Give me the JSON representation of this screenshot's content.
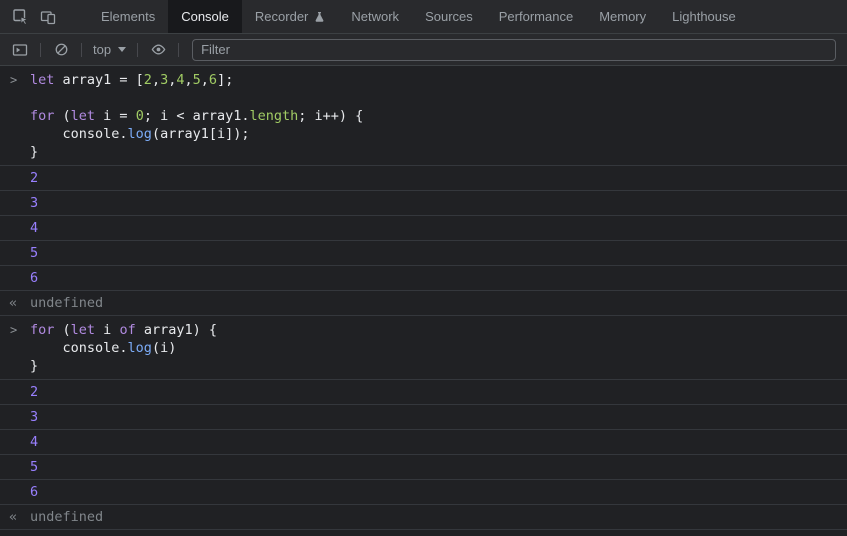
{
  "tabbar": {
    "tabs": [
      {
        "label": "Elements",
        "active": false
      },
      {
        "label": "Console",
        "active": true
      },
      {
        "label": "Recorder",
        "active": false,
        "badge": true
      },
      {
        "label": "Network",
        "active": false
      },
      {
        "label": "Sources",
        "active": false
      },
      {
        "label": "Performance",
        "active": false
      },
      {
        "label": "Memory",
        "active": false
      },
      {
        "label": "Lighthouse",
        "active": false
      }
    ]
  },
  "toolbar": {
    "context_label": "top",
    "filter_placeholder": "Filter"
  },
  "icons": {
    "input_chevron": ">",
    "return_arrow": "«"
  },
  "console_panel": {
    "entries": [
      {
        "type": "input",
        "lines": [
          [
            {
              "c": "kw",
              "t": "let"
            },
            {
              "c": "d",
              "t": " array1 = ["
            },
            {
              "c": "num",
              "t": "2"
            },
            {
              "c": "d",
              "t": ","
            },
            {
              "c": "num",
              "t": "3"
            },
            {
              "c": "d",
              "t": ","
            },
            {
              "c": "num",
              "t": "4"
            },
            {
              "c": "d",
              "t": ","
            },
            {
              "c": "num",
              "t": "5"
            },
            {
              "c": "d",
              "t": ","
            },
            {
              "c": "num",
              "t": "6"
            },
            {
              "c": "d",
              "t": "];"
            }
          ],
          [],
          [
            {
              "c": "kw",
              "t": "for"
            },
            {
              "c": "d",
              "t": " ("
            },
            {
              "c": "kw",
              "t": "let"
            },
            {
              "c": "d",
              "t": " i = "
            },
            {
              "c": "num",
              "t": "0"
            },
            {
              "c": "d",
              "t": "; i < array1."
            },
            {
              "c": "num",
              "t": "length"
            },
            {
              "c": "d",
              "t": "; i++) {"
            }
          ],
          [
            {
              "c": "d",
              "t": "    console."
            },
            {
              "c": "prop",
              "t": "log"
            },
            {
              "c": "d",
              "t": "(array1[i]);"
            }
          ],
          [
            {
              "c": "d",
              "t": "}"
            }
          ]
        ]
      },
      {
        "type": "result",
        "text": "2"
      },
      {
        "type": "result",
        "text": "3"
      },
      {
        "type": "result",
        "text": "4"
      },
      {
        "type": "result",
        "text": "5"
      },
      {
        "type": "result",
        "text": "6"
      },
      {
        "type": "return",
        "text": "undefined"
      },
      {
        "type": "input",
        "lines": [
          [
            {
              "c": "kw",
              "t": "for"
            },
            {
              "c": "d",
              "t": " ("
            },
            {
              "c": "kw",
              "t": "let"
            },
            {
              "c": "d",
              "t": " i "
            },
            {
              "c": "kw",
              "t": "of"
            },
            {
              "c": "d",
              "t": " array1) {"
            }
          ],
          [
            {
              "c": "d",
              "t": "    console."
            },
            {
              "c": "prop",
              "t": "log"
            },
            {
              "c": "d",
              "t": "(i)"
            }
          ],
          [
            {
              "c": "d",
              "t": "}"
            }
          ]
        ]
      },
      {
        "type": "result",
        "text": "2"
      },
      {
        "type": "result",
        "text": "3"
      },
      {
        "type": "result",
        "text": "4"
      },
      {
        "type": "result",
        "text": "5"
      },
      {
        "type": "result",
        "text": "6"
      },
      {
        "type": "return",
        "text": "undefined"
      }
    ]
  },
  "colors": {
    "background": "#202124",
    "chrome_bar": "#292a2d",
    "active_tab_bg": "#18191c",
    "tab_text": "#9aa0a6",
    "active_tab_text": "#e8eaed",
    "border": "#3c4043",
    "row_border": "#34373c",
    "icon": "#9aa0a6",
    "filter_border": "#5a5d62",
    "code_default": "#e8eaed",
    "keyword": "#b18ae0",
    "number_literal": "#a1cc64",
    "property": "#7cacf8",
    "result_number": "#9980ff",
    "muted": "#81868b",
    "chevron": "#8c9196"
  }
}
